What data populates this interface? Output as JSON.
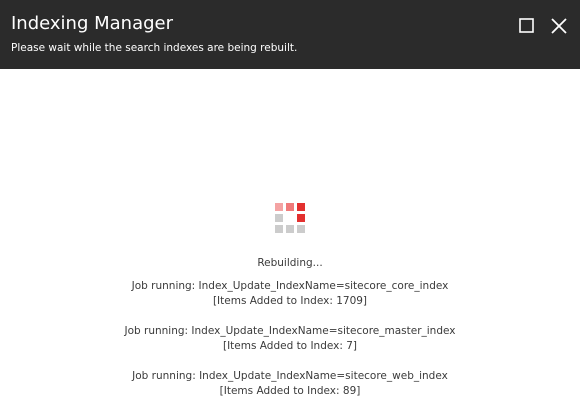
{
  "dialog": {
    "title": "Indexing Manager",
    "subtitle": "Please wait while the search indexes are being rebuilt."
  },
  "window_controls": {
    "maximize_icon": "maximize-icon",
    "close_icon": "close-icon"
  },
  "spinner": {
    "icon": "loading-spinner-icon",
    "colors": {
      "light": "#f4a3a3",
      "mid": "#f07a7a",
      "accent": "#e3302f",
      "gray": "#cccccc"
    }
  },
  "status_text": "Rebuilding...",
  "jobs": [
    {
      "line": "Job running: Index_Update_IndexName=sitecore_core_index",
      "count": "[Items Added to Index: 1709]"
    },
    {
      "line": "Job running: Index_Update_IndexName=sitecore_master_index",
      "count": "[Items Added to Index: 7]"
    },
    {
      "line": "Job running: Index_Update_IndexName=sitecore_web_index",
      "count": "[Items Added to Index: 89]"
    }
  ],
  "colors": {
    "header_bg": "#2b2b2b",
    "header_text": "#ffffff",
    "body_bg": "#ffffff",
    "body_text": "#3a3a3a"
  }
}
